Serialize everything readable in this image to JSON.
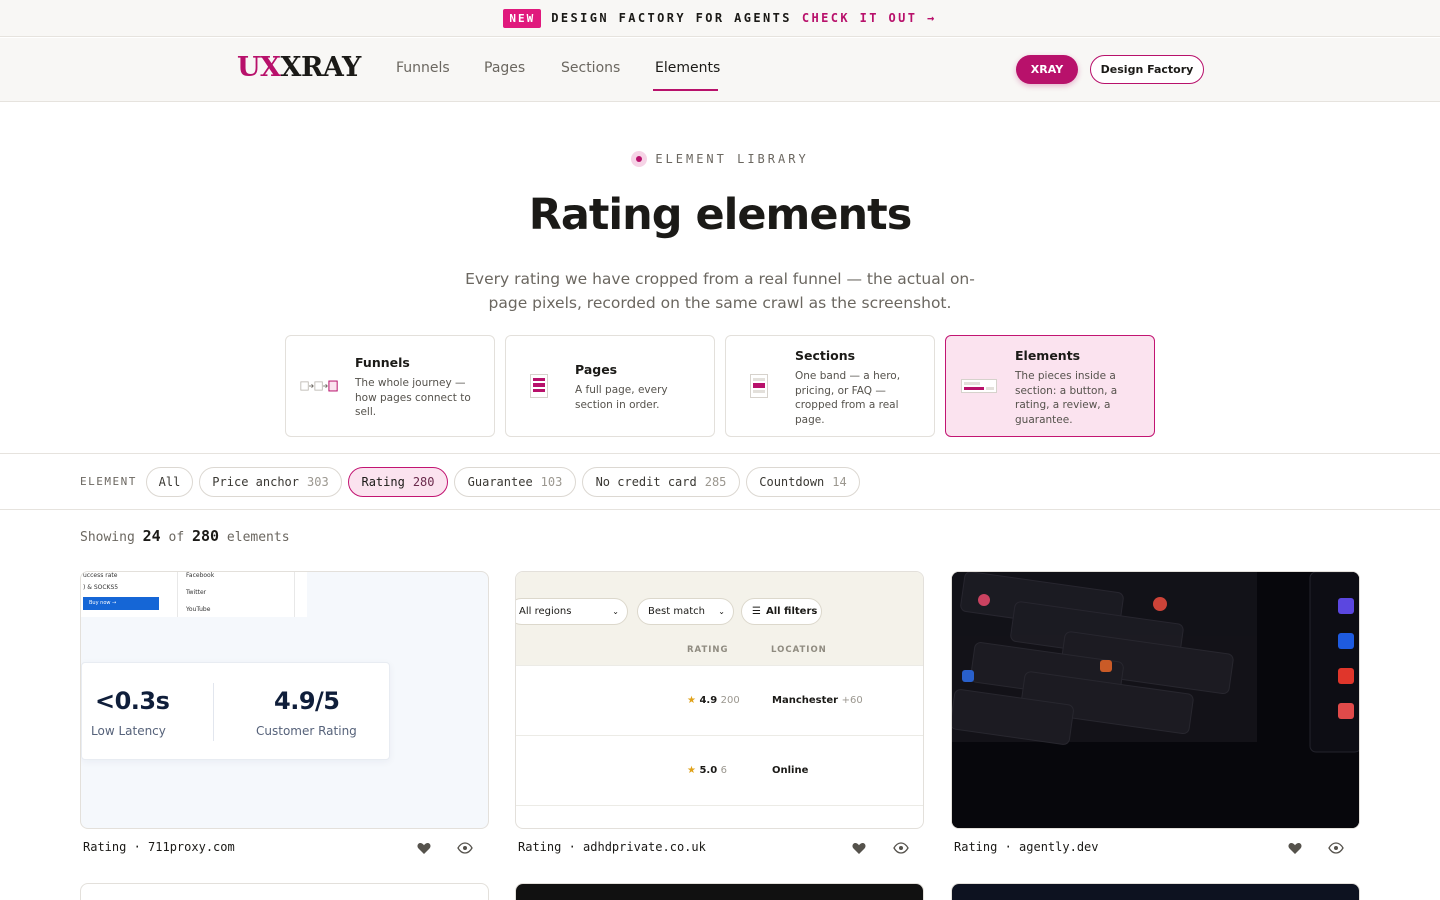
{
  "announcement": {
    "badge": "NEW",
    "message": "DESIGN FACTORY FOR AGENTS",
    "cta": "CHECK IT OUT →"
  },
  "header": {
    "logo_ux": "UX",
    "logo_xray": "XRAY",
    "nav": [
      {
        "label": "Funnels",
        "active": false
      },
      {
        "label": "Pages",
        "active": false
      },
      {
        "label": "Sections",
        "active": false
      },
      {
        "label": "Elements",
        "active": true
      }
    ],
    "xray_button": "XRAY",
    "design_factory_button": "Design Factory"
  },
  "hero": {
    "eyebrow": "ELEMENT LIBRARY",
    "title": "Rating elements",
    "subtitle": "Every rating we have cropped from a real funnel — the actual on-page pixels, recorded on the same crawl as the screenshot."
  },
  "levels": [
    {
      "title": "Funnels",
      "description": "The whole journey — how pages connect to sell.",
      "active": false
    },
    {
      "title": "Pages",
      "description": "A full page, every section in order.",
      "active": false
    },
    {
      "title": "Sections",
      "description": "One band — a hero, pricing, or FAQ — cropped from a real page.",
      "active": false
    },
    {
      "title": "Elements",
      "description": "The pieces inside a section: a button, a rating, a review, a guarantee.",
      "active": true
    }
  ],
  "filters": {
    "label": "ELEMENT",
    "chips": [
      {
        "label": "All",
        "count": "",
        "active": false
      },
      {
        "label": "Price anchor",
        "count": "303",
        "active": false
      },
      {
        "label": "Rating",
        "count": "280",
        "active": true
      },
      {
        "label": "Guarantee",
        "count": "103",
        "active": false
      },
      {
        "label": "No credit card",
        "count": "285",
        "active": false
      },
      {
        "label": "Countdown",
        "count": "14",
        "active": false
      }
    ]
  },
  "showing": {
    "prefix": "Showing",
    "shown": "24",
    "of": "of",
    "total": "280",
    "suffix": "elements"
  },
  "cards": [
    {
      "caption": "Rating · 711proxy.com",
      "mini_lines": [
        "uccess rate",
        ") & SOCKS5",
        "Buy now →"
      ],
      "social": [
        "Facebook",
        "Twitter",
        "YouTube"
      ],
      "stat1_value": "<0.3s",
      "stat1_label": "Low Latency",
      "stat2_value": "4.9/5",
      "stat2_label": "Customer Rating"
    },
    {
      "caption": "Rating · adhdprivate.co.uk",
      "select_region": "All regions",
      "select_sort": "Best match",
      "all_filters": "All filters",
      "col_rating": "RATING",
      "col_location": "LOCATION",
      "rows": [
        {
          "rating": "4.9",
          "count": "200",
          "location": "Manchester",
          "extra": "+60"
        },
        {
          "rating": "5.0",
          "count": "6",
          "location": "Online",
          "extra": ""
        }
      ]
    },
    {
      "caption": "Rating · agently.dev"
    }
  ],
  "colors": {
    "accent": "#b8116b",
    "badge": "#e0197d",
    "active_bg": "#fbe3ef",
    "star": "#e0a21a"
  },
  "icons": {
    "like": "heart-icon",
    "preview": "eye-icon",
    "arrow": "arrow-right-icon"
  }
}
